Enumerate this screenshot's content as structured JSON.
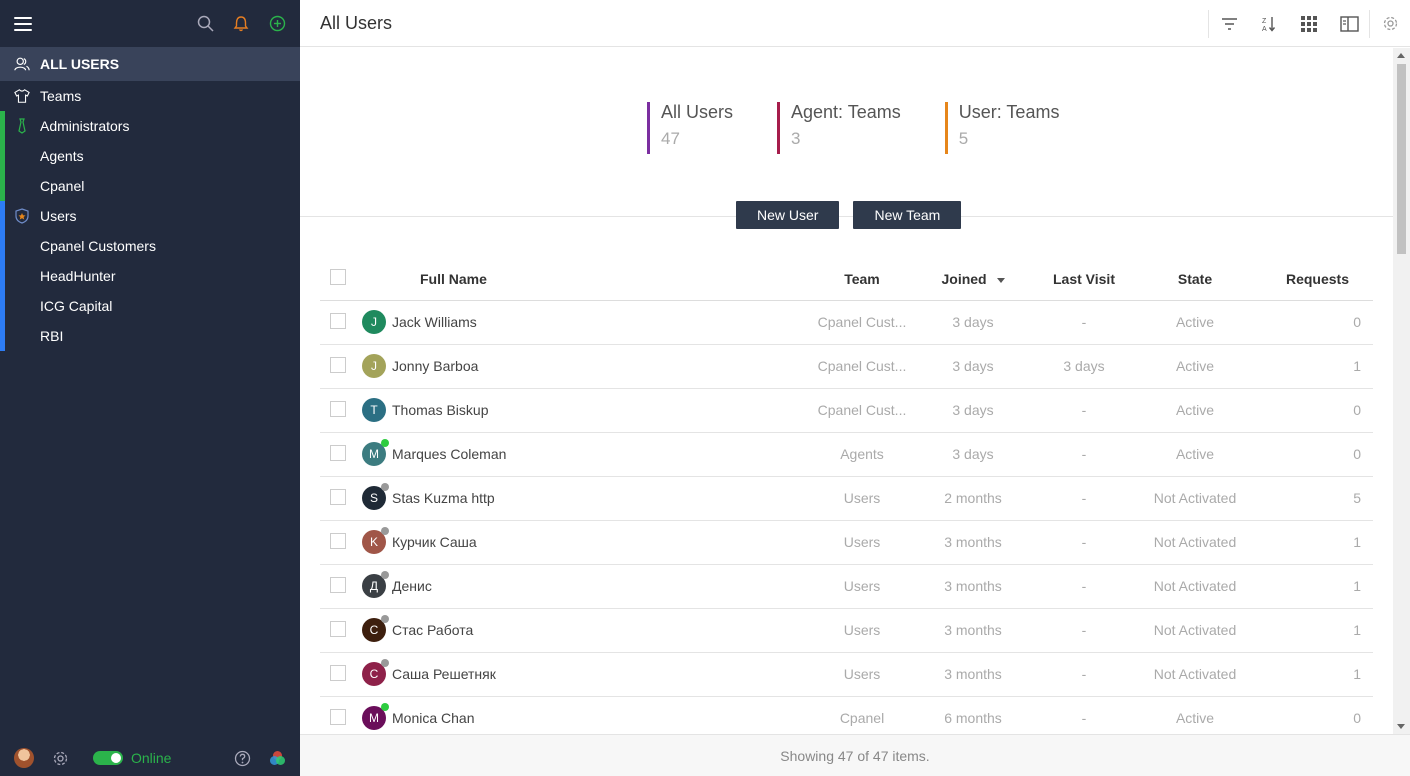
{
  "sidebar": {
    "items": [
      {
        "label": "ALL USERS"
      },
      {
        "label": "Teams"
      },
      {
        "label": "Administrators"
      },
      {
        "label": "Agents"
      },
      {
        "label": "Cpanel"
      },
      {
        "label": "Users"
      },
      {
        "label": "Cpanel Customers"
      },
      {
        "label": "HeadHunter"
      },
      {
        "label": "ICG Capital"
      },
      {
        "label": "RBI"
      }
    ],
    "status": "Online"
  },
  "header": {
    "title": "All Users"
  },
  "stats": [
    {
      "label": "All Users",
      "value": "47",
      "color": "#7b2ea0"
    },
    {
      "label": "Agent: Teams",
      "value": "3",
      "color": "#a61d4b"
    },
    {
      "label": "User: Teams",
      "value": "5",
      "color": "#e6861b"
    }
  ],
  "buttons": {
    "new_user": "New User",
    "new_team": "New Team"
  },
  "table": {
    "columns": {
      "full_name": "Full Name",
      "team": "Team",
      "joined": "Joined",
      "last_visit": "Last Visit",
      "state": "State",
      "requests": "Requests"
    },
    "rows": [
      {
        "initial": "J",
        "color": "#1f8a5e",
        "status": "",
        "name": "Jack Williams",
        "team": "Cpanel Cust...",
        "joined": "3 days",
        "last_visit": "-",
        "state": "Active",
        "requests": "0"
      },
      {
        "initial": "J",
        "color": "#a3a35a",
        "status": "",
        "name": "Jonny Barboa",
        "team": "Cpanel Cust...",
        "joined": "3 days",
        "last_visit": "3 days",
        "state": "Active",
        "requests": "1"
      },
      {
        "initial": "T",
        "color": "#2b6f83",
        "status": "",
        "name": "Thomas Biskup",
        "team": "Cpanel Cust...",
        "joined": "3 days",
        "last_visit": "-",
        "state": "Active",
        "requests": "0"
      },
      {
        "initial": "M",
        "color": "#3c7c80",
        "status": "#2ecc40",
        "name": "Marques Coleman",
        "team": "Agents",
        "joined": "3 days",
        "last_visit": "-",
        "state": "Active",
        "requests": "0"
      },
      {
        "initial": "S",
        "color": "#1f2a36",
        "status": "#999999",
        "name": "Stas Kuzma http",
        "team": "Users",
        "joined": "2 months",
        "last_visit": "-",
        "state": "Not Activated",
        "requests": "5"
      },
      {
        "initial": "K",
        "color": "#a05648",
        "status": "#999999",
        "name": "Курчик Саша",
        "team": "Users",
        "joined": "3 months",
        "last_visit": "-",
        "state": "Not Activated",
        "requests": "1"
      },
      {
        "initial": "Д",
        "color": "#3a3f44",
        "status": "#999999",
        "name": "Денис",
        "team": "Users",
        "joined": "3 months",
        "last_visit": "-",
        "state": "Not Activated",
        "requests": "1"
      },
      {
        "initial": "C",
        "color": "#3d1f0e",
        "status": "#999999",
        "name": "Стас Работа",
        "team": "Users",
        "joined": "3 months",
        "last_visit": "-",
        "state": "Not Activated",
        "requests": "1"
      },
      {
        "initial": "C",
        "color": "#8e2149",
        "status": "#999999",
        "name": "Саша Решетняк",
        "team": "Users",
        "joined": "3 months",
        "last_visit": "-",
        "state": "Not Activated",
        "requests": "1"
      },
      {
        "initial": "M",
        "color": "#6a0e5a",
        "status": "#2ecc40",
        "name": "Monica Chan",
        "team": "Cpanel",
        "joined": "6 months",
        "last_visit": "-",
        "state": "Active",
        "requests": "0"
      }
    ]
  },
  "footer": {
    "summary": "Showing 47 of 47 items."
  }
}
